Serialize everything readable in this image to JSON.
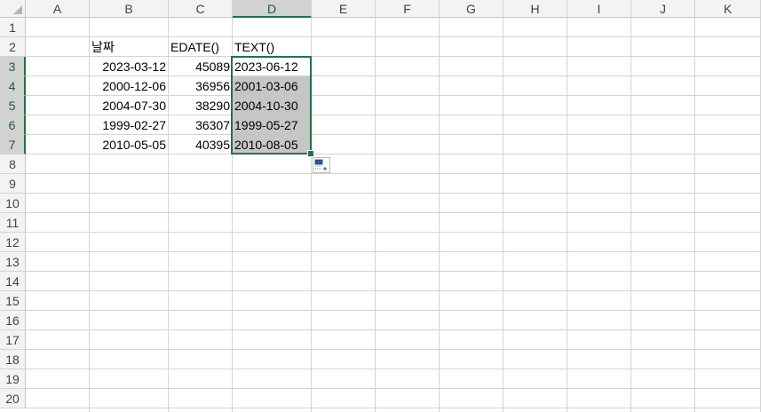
{
  "columns": [
    "A",
    "B",
    "C",
    "D",
    "E",
    "F",
    "G",
    "H",
    "I",
    "J",
    "K"
  ],
  "active_column": "D",
  "rows": [
    "1",
    "2",
    "3",
    "4",
    "5",
    "6",
    "7",
    "8",
    "9",
    "10",
    "11",
    "12",
    "13",
    "14",
    "15",
    "16",
    "17",
    "18",
    "19",
    "20"
  ],
  "active_rows": [
    "3",
    "4",
    "5",
    "6",
    "7"
  ],
  "cells": {
    "B2": "날짜",
    "C2": "EDATE()",
    "D2": "TEXT()",
    "B3": "2023-03-12",
    "C3": "45089",
    "D3": "2023-06-12",
    "B4": "2000-12-06",
    "C4": "36956",
    "D4": "2001-03-06",
    "B5": "2004-07-30",
    "C5": "38290",
    "D5": "2004-10-30",
    "B6": "1999-02-27",
    "C6": "36307",
    "D6": "1999-05-27",
    "B7": "2010-05-05",
    "C7": "40395",
    "D7": "2010-08-05"
  },
  "selection": {
    "from": "D3",
    "to": "D7"
  },
  "colors": {
    "accent": "#217346",
    "selected_fill": "#c6c6c6",
    "header_bg": "#f3f3f3",
    "gridline": "#d4d4d4"
  },
  "icons": {
    "autofill": "autofill-options-icon",
    "corner": "select-all-triangle-icon"
  }
}
